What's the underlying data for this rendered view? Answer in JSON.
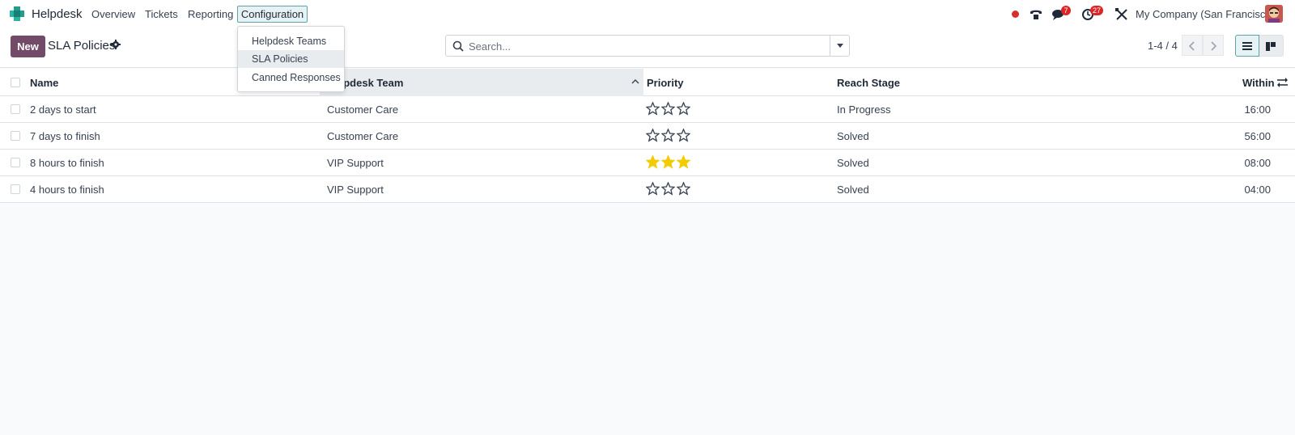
{
  "navbar": {
    "app_name": "Helpdesk",
    "menu": [
      "Overview",
      "Tickets",
      "Reporting",
      "Configuration"
    ],
    "messages_badge": "7",
    "activities_badge": "27",
    "company": "My Company (San Francisco)",
    "icons": [
      "helpdesk-logo-icon",
      "record-icon",
      "phone-icon",
      "chat-icon",
      "clock-icon",
      "tools-icon",
      "user-avatar"
    ]
  },
  "configuration_menu": {
    "items": [
      "Helpdesk Teams",
      "SLA Policies",
      "Canned Responses"
    ],
    "active": "SLA Policies"
  },
  "control_panel": {
    "new_label": "New",
    "title": "SLA Policies",
    "search_placeholder": "Search...",
    "pager": "1-4 / 4"
  },
  "table": {
    "columns": [
      "Name",
      "Helpdesk Team",
      "Priority",
      "Reach Stage",
      "Within"
    ],
    "rows": [
      {
        "name": "2 days to start",
        "team": "Customer Care",
        "priority": 0,
        "stage": "In Progress",
        "within": "16:00"
      },
      {
        "name": "7 days to finish",
        "team": "Customer Care",
        "priority": 0,
        "stage": "Solved",
        "within": "56:00"
      },
      {
        "name": "8 hours to finish",
        "team": "VIP Support",
        "priority": 3,
        "stage": "Solved",
        "within": "08:00"
      },
      {
        "name": "4 hours to finish",
        "team": "VIP Support",
        "priority": 0,
        "stage": "Solved",
        "within": "04:00"
      }
    ]
  },
  "colors": {
    "brand": "#714b67",
    "accent": "#5da4a9",
    "star_filled": "#f3cc00",
    "badge": "#dc2626"
  }
}
